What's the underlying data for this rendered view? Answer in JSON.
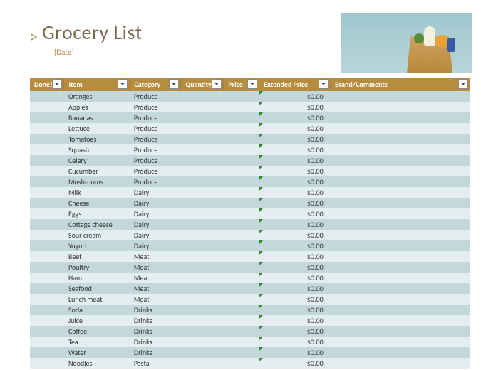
{
  "header": {
    "chevron": ">",
    "title": "Grocery List",
    "subtitle": "[Date]"
  },
  "columns": [
    {
      "key": "done",
      "label": "Done?"
    },
    {
      "key": "item",
      "label": "Item"
    },
    {
      "key": "category",
      "label": "Category"
    },
    {
      "key": "quantity",
      "label": "Quantity"
    },
    {
      "key": "price",
      "label": "Price"
    },
    {
      "key": "extended",
      "label": "Extended Price"
    },
    {
      "key": "brand",
      "label": "Brand/Comments"
    }
  ],
  "rows": [
    {
      "item": "Oranges",
      "category": "Produce",
      "extended": "$0.00"
    },
    {
      "item": "Apples",
      "category": "Produce",
      "extended": "$0.00"
    },
    {
      "item": "Bananas",
      "category": "Produce",
      "extended": "$0.00"
    },
    {
      "item": "Lettuce",
      "category": "Produce",
      "extended": "$0.00"
    },
    {
      "item": "Tomatoes",
      "category": "Produce",
      "extended": "$0.00"
    },
    {
      "item": "Squash",
      "category": "Produce",
      "extended": "$0.00"
    },
    {
      "item": "Celery",
      "category": "Produce",
      "extended": "$0.00"
    },
    {
      "item": "Cucumber",
      "category": "Produce",
      "extended": "$0.00"
    },
    {
      "item": "Mushrooms",
      "category": "Produce",
      "extended": "$0.00"
    },
    {
      "item": "Milk",
      "category": "Dairy",
      "extended": "$0.00"
    },
    {
      "item": "Cheese",
      "category": "Dairy",
      "extended": "$0.00"
    },
    {
      "item": "Eggs",
      "category": "Dairy",
      "extended": "$0.00"
    },
    {
      "item": "Cottage cheese",
      "category": "Dairy",
      "extended": "$0.00"
    },
    {
      "item": "Sour cream",
      "category": "Dairy",
      "extended": "$0.00"
    },
    {
      "item": "Yogurt",
      "category": "Dairy",
      "extended": "$0.00"
    },
    {
      "item": "Beef",
      "category": "Meat",
      "extended": "$0.00"
    },
    {
      "item": "Poultry",
      "category": "Meat",
      "extended": "$0.00"
    },
    {
      "item": "Ham",
      "category": "Meat",
      "extended": "$0.00"
    },
    {
      "item": "Seafood",
      "category": "Meat",
      "extended": "$0.00"
    },
    {
      "item": "Lunch meat",
      "category": "Meat",
      "extended": "$0.00"
    },
    {
      "item": "Soda",
      "category": "Drinks",
      "extended": "$0.00"
    },
    {
      "item": "Juice",
      "category": "Drinks",
      "extended": "$0.00"
    },
    {
      "item": "Coffee",
      "category": "Drinks",
      "extended": "$0.00"
    },
    {
      "item": "Tea",
      "category": "Drinks",
      "extended": "$0.00"
    },
    {
      "item": "Water",
      "category": "Drinks",
      "extended": "$0.00"
    },
    {
      "item": "Noodles",
      "category": "Pasta",
      "extended": "$0.00"
    }
  ]
}
